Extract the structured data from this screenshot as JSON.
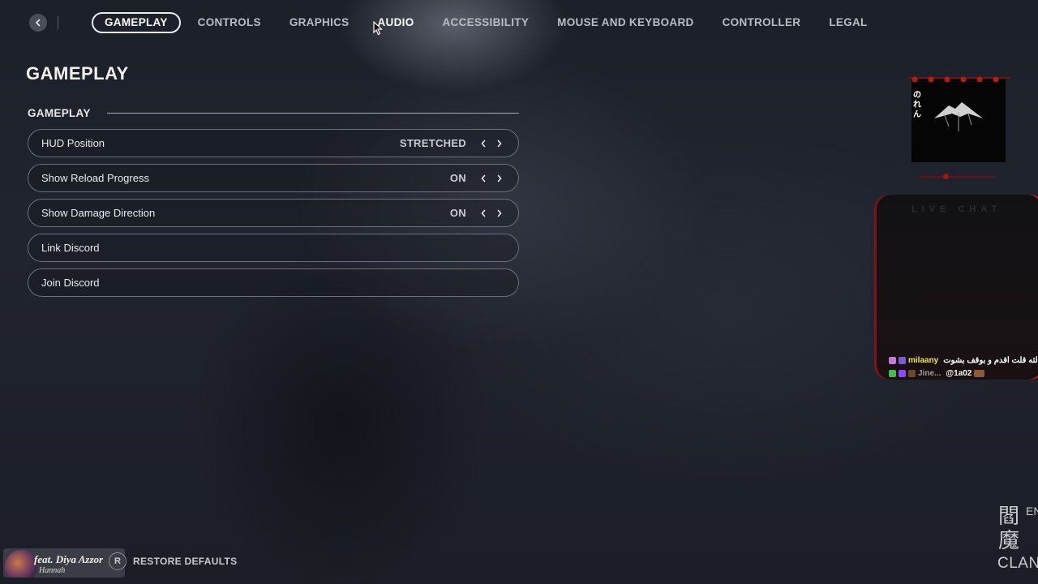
{
  "nav": {
    "tabs": [
      {
        "label": "GAMEPLAY"
      },
      {
        "label": "CONTROLS"
      },
      {
        "label": "GRAPHICS"
      },
      {
        "label": "AUDIO"
      },
      {
        "label": "ACCESSIBILITY"
      },
      {
        "label": "MOUSE AND KEYBOARD"
      },
      {
        "label": "CONTROLLER"
      },
      {
        "label": "LEGAL"
      }
    ],
    "active_tab": "GAMEPLAY",
    "hovered_tab": "AUDIO"
  },
  "page": {
    "title": "GAMEPLAY",
    "section_title": "GAMEPLAY"
  },
  "settings": [
    {
      "label": "HUD Position",
      "value": "STRETCHED"
    },
    {
      "label": "Show Reload Progress",
      "value": "ON"
    },
    {
      "label": "Show Damage Direction",
      "value": "ON"
    },
    {
      "label": "Link Discord",
      "value": ""
    },
    {
      "label": "Join Discord",
      "value": ""
    }
  ],
  "footer": {
    "restore_key": "R",
    "restore_label": "RESTORE DEFAULTS"
  },
  "overlay": {
    "music": {
      "title": "feat. Diya Azzor",
      "artist": "Hannah"
    },
    "chat_title": "LIVE CHAT",
    "chat": [
      {
        "user": "milaany",
        "message": "الثالثه قلت اقدم و بوقف بشوت",
        "user_color": "#e8e84a"
      },
      {
        "user": "Jine...",
        "message": "@1a02",
        "user_color": "#9a9aa0"
      }
    ],
    "clan": {
      "kanji": "閻魔",
      "letters": "ENMA",
      "word": "CLAN"
    }
  },
  "colors": {
    "background": "#1e222b",
    "accent_red": "#c4161c",
    "row_border": "#6d7079"
  }
}
